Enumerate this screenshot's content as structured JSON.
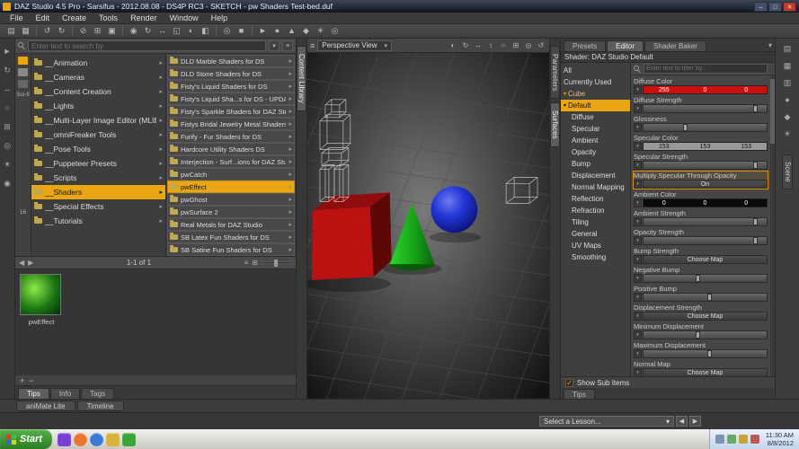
{
  "glyphs": {
    "minimize": "–",
    "maximize": "□",
    "close": "✕",
    "menu": "≡",
    "dropdown": "▾",
    "back": "◀",
    "forward": "▶",
    "list_view": "≡",
    "grid_view": "⊞",
    "plus": "+",
    "minus": "−",
    "check": "✓",
    "expander": "▾",
    "pane_menu": "▾"
  },
  "window": {
    "title": "DAZ Studio 4.5 Pro - Sarsifus - 2012.08.08 - DS4P RC3 - SKETCH - pw Shaders Test-bed.duf"
  },
  "menu": {
    "items": [
      "File",
      "Edit",
      "Create",
      "Tools",
      "Render",
      "Window",
      "Help"
    ]
  },
  "main_toolbar": {
    "icons": [
      {
        "name": "open-file-icon",
        "glyph": "▤"
      },
      {
        "name": "save-file-icon",
        "glyph": "▦"
      },
      {
        "sep": true
      },
      {
        "name": "undo-icon",
        "glyph": "↺"
      },
      {
        "name": "redo-icon",
        "glyph": "↻"
      },
      {
        "sep": true
      },
      {
        "name": "cut-icon",
        "glyph": "⊘"
      },
      {
        "name": "copy-icon",
        "glyph": "⊞"
      },
      {
        "name": "paste-icon",
        "glyph": "▣"
      },
      {
        "sep": true
      },
      {
        "name": "scene-select-icon",
        "glyph": "◉"
      },
      {
        "name": "rotate-tool-icon",
        "glyph": "↻"
      },
      {
        "name": "translate-tool-icon",
        "glyph": "↔"
      },
      {
        "name": "scale-tool-icon",
        "glyph": "◱"
      },
      {
        "name": "active-pose-tool-icon",
        "glyph": "◐"
      },
      {
        "name": "surface-selection-tool-icon",
        "glyph": "◧"
      },
      {
        "sep": true
      },
      {
        "name": "spot-render-icon",
        "glyph": "◎"
      },
      {
        "name": "render-icon",
        "glyph": "■"
      },
      {
        "sep": true
      },
      {
        "name": "animate-icon",
        "glyph": "►"
      },
      {
        "name": "puppeteer-icon",
        "glyph": "●"
      },
      {
        "name": "powerpose-icon",
        "glyph": "▲"
      },
      {
        "name": "shader-mixer-icon",
        "glyph": "◆"
      },
      {
        "name": "lights-icon",
        "glyph": "☀"
      },
      {
        "name": "cameras-icon",
        "glyph": "◎"
      }
    ]
  },
  "side_toolbar": {
    "icons": [
      {
        "name": "node-select-icon",
        "glyph": "►"
      },
      {
        "name": "orbit-icon",
        "glyph": "↻"
      },
      {
        "name": "pan-icon",
        "glyph": "↔"
      },
      {
        "name": "zoom-icon",
        "glyph": "○"
      },
      {
        "name": "frame-icon",
        "glyph": "⊞"
      },
      {
        "name": "camera-icon",
        "glyph": "◎"
      },
      {
        "name": "light-icon",
        "glyph": "☀"
      },
      {
        "name": "node-icon",
        "glyph": "◉"
      }
    ]
  },
  "dock_tabs": {
    "left": "Content Library",
    "right": [
      "Parameters",
      "Surfaces"
    ],
    "right_active": "Surfaces"
  },
  "content_library": {
    "search_placeholder": "Enter text to search by",
    "side_rail": {
      "labels": [
        "Sci-fi",
        "16"
      ],
      "icons": [
        {
          "name": "daz-formats-icon",
          "color": "#e9a512"
        },
        {
          "name": "poser-formats-icon",
          "color": "#8a8a8a"
        },
        {
          "name": "other-formats-icon",
          "color": "#666666"
        }
      ]
    },
    "categories": [
      {
        "label": "__Animation"
      },
      {
        "label": "__Cameras"
      },
      {
        "label": "__Content Creation"
      },
      {
        "label": "__Lights"
      },
      {
        "label": "__Multi-Layer Image Editor (MLIE)"
      },
      {
        "label": "__omniFreaker Tools"
      },
      {
        "label": "__Pose Tools"
      },
      {
        "label": "__Puppeteer Presets"
      },
      {
        "label": "__Scripts"
      },
      {
        "label": "__Shaders",
        "selected": true
      },
      {
        "label": "__Special Effects"
      },
      {
        "label": "__Tutorials"
      }
    ],
    "products": [
      {
        "label": "DLD Marble Shaders for DS"
      },
      {
        "label": "DLD Stone Shaders for DS"
      },
      {
        "label": "Fisty's Liquid Shaders for DS"
      },
      {
        "label": "Fisty's Liquid Sha...s for DS - UPDAT"
      },
      {
        "label": "Fisty's Sparkle Shaders for DAZ Stu"
      },
      {
        "label": "Fistys Bridal Jewelry Metal Shaders"
      },
      {
        "label": "Furify - Fur Shaders for DS"
      },
      {
        "label": "Hardcore Utility Shaders DS"
      },
      {
        "label": "Interjection - Surf...ions for DAZ Stu"
      },
      {
        "label": "pwCatch"
      },
      {
        "label": "pwEffect",
        "selected": true
      },
      {
        "label": "pwGhost"
      },
      {
        "label": "pwSurface 2"
      },
      {
        "label": "Real Metals for DAZ Studio"
      },
      {
        "label": "SB Latex Fun Shaders for DS"
      },
      {
        "label": "SB Satine Fun Shaders for DS"
      }
    ],
    "result_count": "1-1 of 1",
    "selected_item": {
      "label": "pwEffect"
    },
    "bottom_tabs": [
      "Tips",
      "Info",
      "Tags"
    ],
    "active_bottom_tab": "Tips"
  },
  "viewport": {
    "camera": "Perspective View",
    "icons": [
      {
        "name": "draw-style-icon",
        "glyph": "◐"
      },
      {
        "name": "orbit-view-icon",
        "glyph": "↻"
      },
      {
        "name": "pan-view-icon",
        "glyph": "↔"
      },
      {
        "name": "dolly-view-icon",
        "glyph": "↕"
      },
      {
        "name": "zoom-view-icon",
        "glyph": "○"
      },
      {
        "name": "frame-view-icon",
        "glyph": "⊞"
      },
      {
        "name": "aim-view-icon",
        "glyph": "◎"
      },
      {
        "name": "reset-view-icon",
        "glyph": "↺"
      }
    ]
  },
  "surfaces": {
    "tabs": [
      "Presets",
      "Editor",
      "Shader Baker"
    ],
    "active_tab": "Editor",
    "header": "Shader: DAZ Studio Default",
    "filter_placeholder": "Enter text to filter by...",
    "tree": [
      {
        "label": "All"
      },
      {
        "label": "Currently Used"
      },
      {
        "label": "Cube",
        "expander": true,
        "group": true
      },
      {
        "label": "Default",
        "expander": true,
        "selected": true
      },
      {
        "label": "Diffuse",
        "indent": true
      },
      {
        "label": "Specular",
        "indent": true
      },
      {
        "label": "Ambient",
        "indent": true
      },
      {
        "label": "Opacity",
        "indent": true
      },
      {
        "label": "Bump",
        "indent": true
      },
      {
        "label": "Displacement",
        "indent": true
      },
      {
        "label": "Normal Mapping",
        "indent": true
      },
      {
        "label": "Reflection",
        "indent": true
      },
      {
        "label": "Refraction",
        "indent": true
      },
      {
        "label": "Tiling",
        "indent": true
      },
      {
        "label": "General",
        "indent": true
      },
      {
        "label": "UV Maps",
        "indent": true
      },
      {
        "label": "Smoothing",
        "indent": true
      }
    ],
    "properties": [
      {
        "label": "Diffuse Color",
        "type": "color",
        "swatch": "#cc0f0f",
        "text_color": "#ffffff",
        "values": [
          "255",
          "0",
          "0"
        ]
      },
      {
        "label": "Diffuse Strength",
        "type": "slider",
        "pos": 92
      },
      {
        "label": "Glossiness",
        "type": "slider",
        "pos": 35
      },
      {
        "label": "Specular Color",
        "type": "color",
        "swatch": "#999999",
        "text_color": "#111111",
        "values": [
          "153",
          "153",
          "153"
        ]
      },
      {
        "label": "Specular Strength",
        "type": "slider",
        "pos": 92
      },
      {
        "label": "Multiply Specular Through Opacity",
        "type": "toggle",
        "value": "On",
        "highlight": true
      },
      {
        "label": "Ambient Color",
        "type": "color",
        "swatch": "#0a0a0a",
        "text_color": "#ffffff",
        "values": [
          "0",
          "0",
          "0"
        ]
      },
      {
        "label": "Ambient Strength",
        "type": "slider",
        "pos": 92
      },
      {
        "label": "Opacity Strength",
        "type": "slider",
        "pos": 92
      },
      {
        "label": "Bump Strength",
        "type": "map",
        "value": "Choose Map"
      },
      {
        "label": "Negative Bump",
        "type": "slider",
        "pos": 45
      },
      {
        "label": "Positive Bump",
        "type": "slider",
        "pos": 55
      },
      {
        "label": "Displacement Strength",
        "type": "map",
        "value": "Choose Map"
      },
      {
        "label": "Minimum Displacement",
        "type": "slider",
        "pos": 45
      },
      {
        "label": "Maximum Displacement",
        "type": "slider",
        "pos": 55
      },
      {
        "label": "Normal Map",
        "type": "map",
        "value": "Choose Map"
      }
    ],
    "show_sub_items_label": "Show Sub Items",
    "show_sub_items_checked": true,
    "bottom_tab": "Tips"
  },
  "right_strip": {
    "label": "Scene",
    "icons": [
      {
        "name": "scene-pane-icon",
        "glyph": "▤"
      },
      {
        "name": "smart-content-icon",
        "glyph": "▦"
      },
      {
        "name": "parameters-pane-icon",
        "glyph": "▥"
      },
      {
        "name": "posing-pane-icon",
        "glyph": "●"
      },
      {
        "name": "shaping-pane-icon",
        "glyph": "◆"
      },
      {
        "name": "lights-pane-icon",
        "glyph": "☀"
      }
    ]
  },
  "bottom_dock_tabs": [
    "aniMate Lite",
    "Timeline"
  ],
  "lesson_bar": {
    "label": "Select a Lesson..."
  },
  "taskbar": {
    "start_label": "Start",
    "quick_launch": [
      {
        "name": "media-app-icon",
        "color": "#7a3fd4",
        "shape": "square"
      },
      {
        "name": "firefox-icon",
        "color": "#e8762c",
        "shape": "circle"
      },
      {
        "name": "messenger-icon",
        "color": "#3a7ad4",
        "shape": "circle"
      },
      {
        "name": "explorer-folder-icon",
        "color": "#d8b23a",
        "shape": "square"
      },
      {
        "name": "daz-app-icon",
        "color": "#3aa43a",
        "shape": "square"
      }
    ],
    "tray_icons": [
      {
        "name": "tray-network-icon",
        "color": "#7a94b0"
      },
      {
        "name": "tray-volume-icon",
        "color": "#6aa86a"
      },
      {
        "name": "tray-update-icon",
        "color": "#c8a23a"
      },
      {
        "name": "tray-antivirus-icon",
        "color": "#b85a5a"
      }
    ],
    "clock": {
      "time": "11:30 AM",
      "date": "8/8/2012"
    }
  }
}
